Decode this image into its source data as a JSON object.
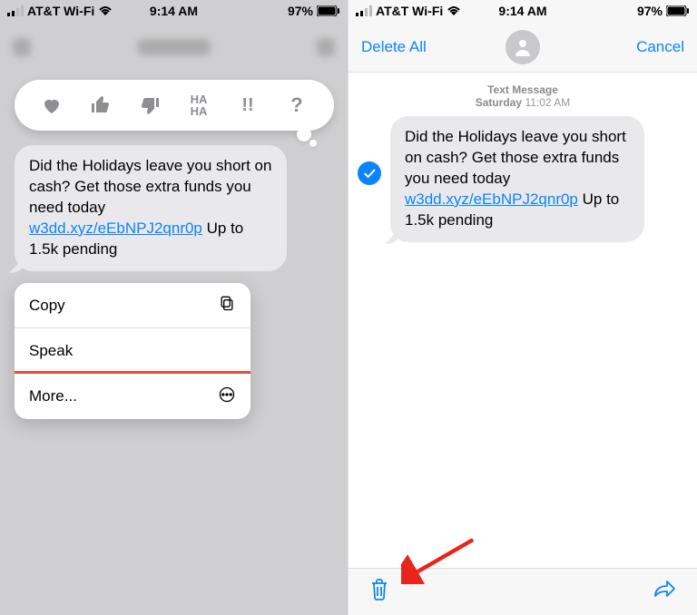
{
  "status_bar": {
    "carrier": "AT&T Wi-Fi",
    "time": "9:14 AM",
    "battery_percent": "97%"
  },
  "left_screen": {
    "tapback_icons": [
      "heart-icon",
      "thumbs-up-icon",
      "thumbs-down-icon",
      "haha-icon",
      "exclaim-icon",
      "question-icon"
    ],
    "message": {
      "text_before_link": "Did the Holidays leave you short on cash? Get those extra funds you need today ",
      "link_text": "w3dd.xyz/eEbNPJ2qnr0p",
      "text_after_link": " Up to 1.5k pending"
    },
    "action_sheet": {
      "copy": {
        "label": "Copy",
        "icon": "copy-icon"
      },
      "speak": {
        "label": "Speak"
      },
      "more": {
        "label": "More...",
        "icon": "more-icon"
      }
    }
  },
  "right_screen": {
    "nav": {
      "delete_all": "Delete All",
      "cancel": "Cancel"
    },
    "timestamp": {
      "label": "Text Message",
      "day": "Saturday",
      "time": "11:02 AM"
    },
    "message": {
      "text_before_link": "Did the Holidays leave you short on cash? Get those extra funds you need today ",
      "link_text": "w3dd.xyz/eEbNPJ2qnr0p",
      "text_after_link": " Up to 1.5k pending"
    },
    "toolbar": {
      "trash": "trash-icon",
      "forward": "forward-icon"
    }
  },
  "annotations": {
    "highlight_more_row": true,
    "red_arrow_to_trash": true
  },
  "colors": {
    "ios_blue": "#0b84ff",
    "ios_gray_bubble": "#e9e9eb",
    "highlight_red": "#f2463a"
  }
}
